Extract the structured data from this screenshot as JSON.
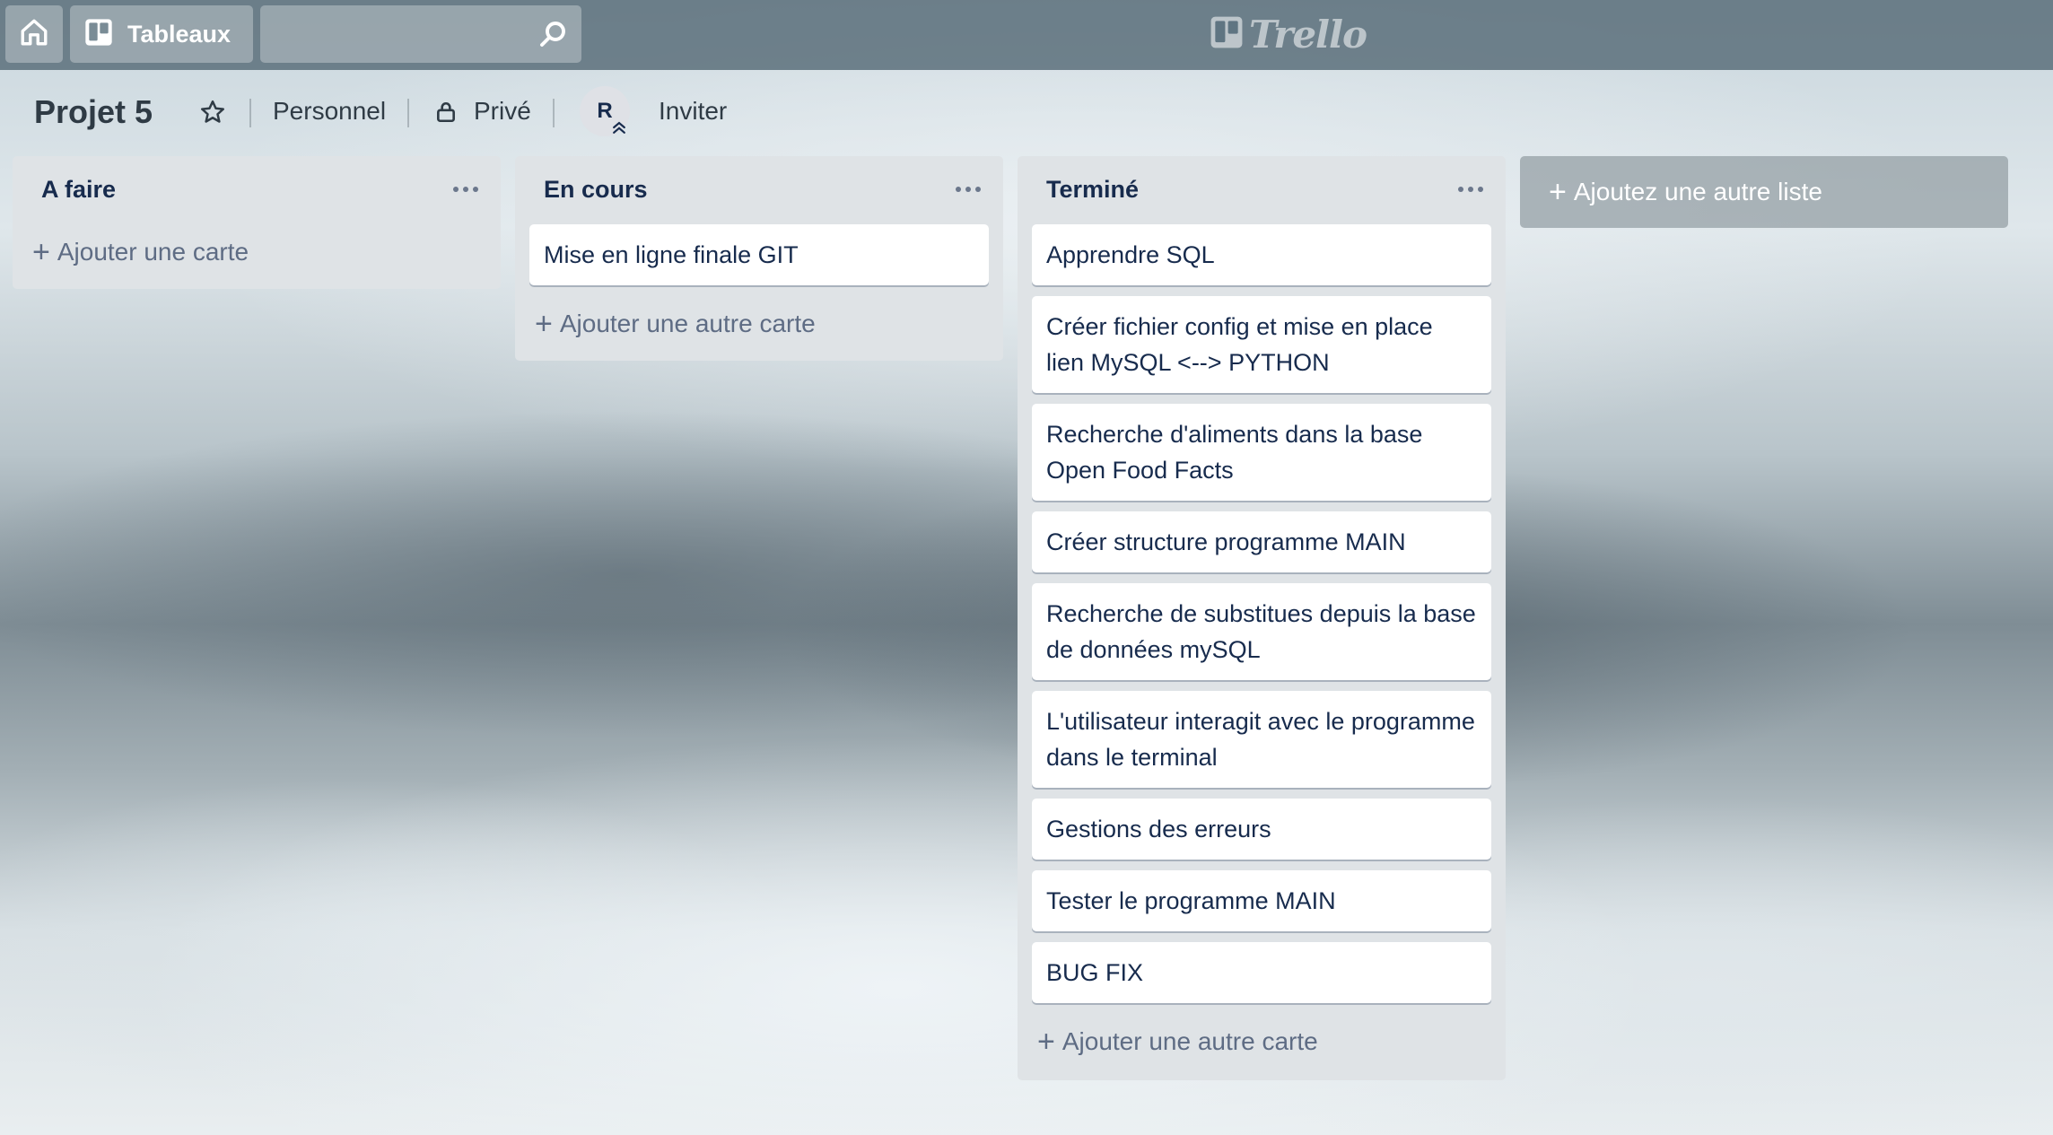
{
  "header": {
    "home_icon": "home-icon",
    "boards_label": "Tableaux",
    "search_placeholder": "",
    "logo_text": "Trello"
  },
  "board": {
    "title": "Projet 5",
    "visibility_team": "Personnel",
    "visibility": "Privé",
    "member_initial": "R",
    "invite_label": "Inviter"
  },
  "lists": [
    {
      "title": "A faire",
      "cards": [],
      "add_label": "Ajouter une carte"
    },
    {
      "title": "En cours",
      "cards": [
        "Mise en ligne finale GIT"
      ],
      "add_label": "Ajouter une autre carte"
    },
    {
      "title": "Terminé",
      "cards": [
        "Apprendre SQL",
        "Créer fichier config et mise en place lien MySQL <--> PYTHON",
        "Recherche d'aliments dans la base Open Food Facts",
        "Créer structure programme MAIN",
        "Recherche de substitues depuis la base de données mySQL",
        "L'utilisateur interagit avec le programme dans le terminal",
        "Gestions des erreurs",
        "Tester le programme MAIN",
        "BUG FIX"
      ],
      "add_label": "Ajouter une autre carte"
    }
  ],
  "add_list_label": "Ajoutez une autre liste"
}
